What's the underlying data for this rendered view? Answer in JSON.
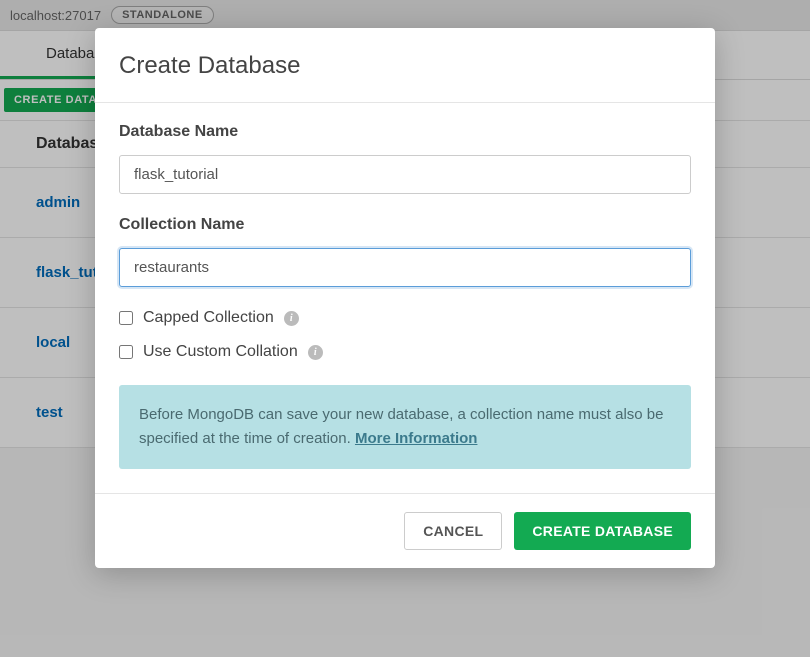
{
  "header": {
    "host": "localhost:27017",
    "badge": "STANDALONE"
  },
  "tabs": {
    "databases": "Databases"
  },
  "actions": {
    "create_database": "CREATE DATABASE"
  },
  "table": {
    "header": "Database Name",
    "rows": [
      "admin",
      "flask_tutorial",
      "local",
      "test"
    ]
  },
  "modal": {
    "title": "Create Database",
    "db_name_label": "Database Name",
    "db_name_value": "flask_tutorial",
    "collection_name_label": "Collection Name",
    "collection_name_value": "restaurants",
    "capped_label": "Capped Collection",
    "collation_label": "Use Custom Collation",
    "notice_text": "Before MongoDB can save your new database, a collection name must also be specified at the time of creation. ",
    "notice_link": "More Information",
    "cancel": "CANCEL",
    "submit": "CREATE DATABASE"
  }
}
